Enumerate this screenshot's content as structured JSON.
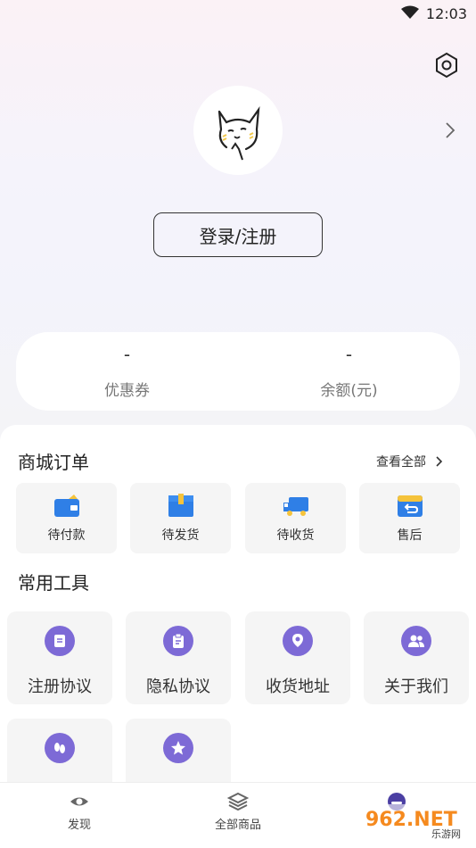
{
  "status_bar": {
    "time": "12:03"
  },
  "profile": {
    "login_label": "登录/注册"
  },
  "wallet": [
    {
      "value": "-",
      "label": "优惠券"
    },
    {
      "value": "-",
      "label": "余额(元)"
    }
  ],
  "orders": {
    "title": "商城订单",
    "view_all": "查看全部",
    "items": [
      {
        "label": "待付款",
        "icon": "wallet-icon"
      },
      {
        "label": "待发货",
        "icon": "package-icon"
      },
      {
        "label": "待收货",
        "icon": "truck-icon"
      },
      {
        "label": "售后",
        "icon": "return-icon"
      }
    ]
  },
  "tools": {
    "title": "常用工具",
    "items": [
      {
        "label": "注册协议",
        "icon": "document-icon"
      },
      {
        "label": "隐私协议",
        "icon": "clipboard-icon"
      },
      {
        "label": "收货地址",
        "icon": "location-icon"
      },
      {
        "label": "关于我们",
        "icon": "people-icon"
      },
      {
        "label": "",
        "icon": "footprint-icon"
      },
      {
        "label": "",
        "icon": "star-icon"
      }
    ]
  },
  "tabbar": [
    {
      "label": "发现",
      "icon": "eye-icon"
    },
    {
      "label": "全部商品",
      "icon": "layers-icon"
    },
    {
      "label": "",
      "icon": "profile-icon"
    }
  ],
  "watermark": {
    "text": "962.NET",
    "subtext": "乐游网"
  },
  "colors": {
    "accent": "#7d6ad6",
    "order_blue": "#2f7fe6",
    "order_yellow": "#f5c33b"
  }
}
